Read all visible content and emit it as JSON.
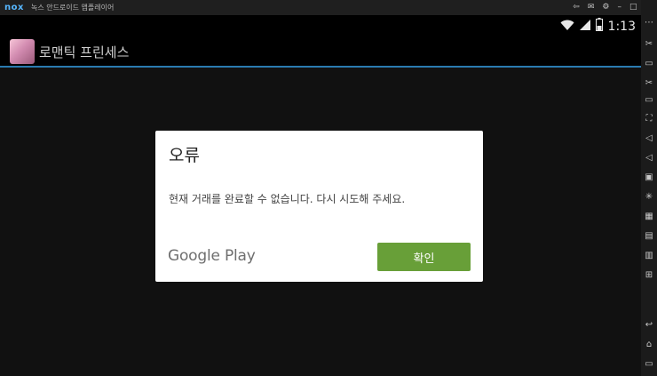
{
  "window": {
    "logo": "nox",
    "title": "녹스 안드로이드 앱플레이어"
  },
  "status_bar": {
    "time": "1:13"
  },
  "action_bar": {
    "app_title": "로맨틱 프린세스"
  },
  "dialog": {
    "title": "오류",
    "message": "현재 거래를 완료할 수 없습니다. 다시 시도해 주세요.",
    "brand": "Google Play",
    "ok_label": "확인",
    "ok_color": "#689f38"
  },
  "colors": {
    "accent_line": "#2a7ab0",
    "logo": "#57b7ff"
  }
}
